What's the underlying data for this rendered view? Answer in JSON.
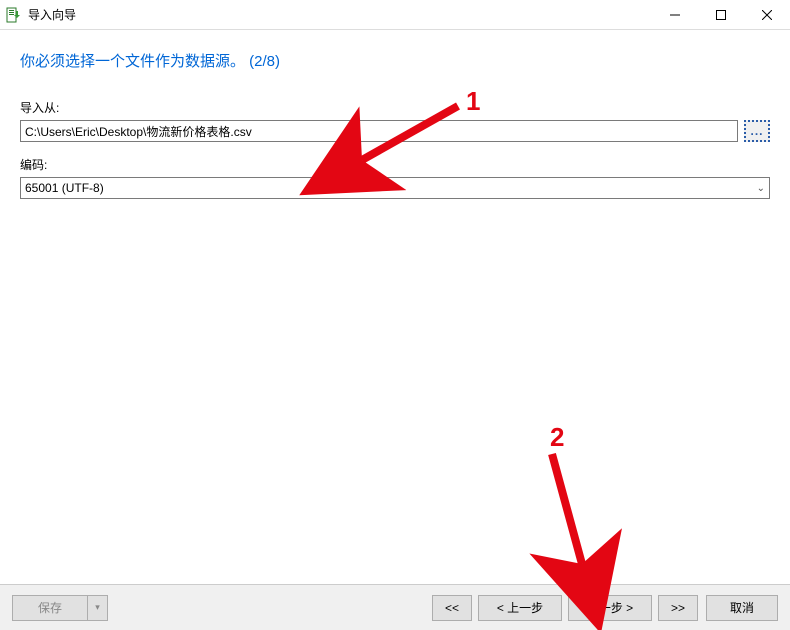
{
  "window": {
    "title": "导入向导"
  },
  "heading": "你必须选择一个文件作为数据源。  (2/8)",
  "import_from_label": "导入从:",
  "import_from_value": "C:\\Users\\Eric\\Desktop\\物流新价格表格.csv",
  "browse_label": "...",
  "encoding_label": "编码:",
  "encoding_value": "65001 (UTF-8)",
  "footer": {
    "save": "保存",
    "first": "<<",
    "prev": "< 上一步",
    "next": "下一步 >",
    "last": ">>",
    "cancel": "取消"
  },
  "annotations": {
    "one": "1",
    "two": "2"
  }
}
